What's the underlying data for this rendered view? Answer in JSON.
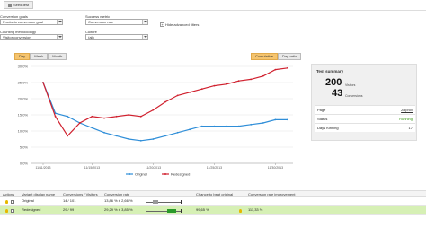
{
  "tab": {
    "label": "Seed-test"
  },
  "filters": {
    "conversion_goals": {
      "label": "Conversion goals",
      "value": "Products conversion goal"
    },
    "success_metric": {
      "label": "Success metric",
      "value": "Conversion rate"
    },
    "counting_methodology": {
      "label": "Counting methodology",
      "value": "Visitor conversion"
    },
    "culture": {
      "label": "Culture",
      "value": "(all)"
    },
    "hide_advanced": "Hide advanced filters"
  },
  "range_tabs": [
    "Day",
    "Week",
    "Month"
  ],
  "mode_tabs": [
    "Cumulative",
    "Day-ratio"
  ],
  "chart_data": {
    "type": "line",
    "x": [
      "11/11/2013",
      "11/12/2013",
      "11/13/2013",
      "11/14/2013",
      "11/15/2013",
      "11/16/2013",
      "11/17/2013",
      "11/18/2013",
      "11/19/2013",
      "11/20/2013",
      "11/21/2013",
      "11/22/2013",
      "11/23/2013",
      "11/24/2013",
      "11/25/2013",
      "11/26/2013",
      "11/27/2013",
      "11/28/2013",
      "11/29/2013",
      "11/30/2013",
      "12/1/2013"
    ],
    "x_tick_labels": [
      "11/11/2013",
      "11/15/2013",
      "11/20/2013",
      "11/25/2013",
      "11/30/2013"
    ],
    "x_tick_indices": [
      0,
      4,
      9,
      14,
      19
    ],
    "ylim": [
      0,
      30
    ],
    "y_ticks": [
      "0,0%",
      "5,0%",
      "10,0%",
      "15,0%",
      "20,0%",
      "25,0%",
      "30,0%"
    ],
    "series": [
      {
        "name": "Original",
        "color": "#2f8ed8",
        "values": [
          25.0,
          15.5,
          14.5,
          12.5,
          11.0,
          9.5,
          8.5,
          7.5,
          7.0,
          7.5,
          8.5,
          9.5,
          10.5,
          11.5,
          11.5,
          11.5,
          11.5,
          12.0,
          12.5,
          13.5,
          13.5
        ]
      },
      {
        "name": "Redesigned",
        "color": "#d0202e",
        "values": [
          25.0,
          14.5,
          8.5,
          12.5,
          14.5,
          14.0,
          14.5,
          15.0,
          14.5,
          16.5,
          19.0,
          21.0,
          22.0,
          23.0,
          24.0,
          24.5,
          25.5,
          26.0,
          27.0,
          29.0,
          29.5
        ]
      }
    ],
    "legend": "bottom"
  },
  "summary": {
    "title": "Test summary",
    "visitors_value": "200",
    "visitors_label": "Visitors",
    "conversions_value": "43",
    "conversions_label": "Conversions",
    "rows": [
      {
        "key": "Page",
        "value": "Zillprox"
      },
      {
        "key": "Status",
        "value": "Running"
      },
      {
        "key": "Days running",
        "value": "17"
      }
    ]
  },
  "table": {
    "headers": [
      "Actions",
      "Variant display name",
      "Conversions / Visitors",
      "Conversion rate",
      "Chance to beat original",
      "Conversion rate improvement"
    ],
    "rows": [
      {
        "name": "Original",
        "conv": "14 / 101",
        "rate": "13,86 % ± 2,66 %",
        "chance": "",
        "improvement": ""
      },
      {
        "name": "Redesigned",
        "conv": "29 / 99",
        "rate": "29,29 % ± 3,85 %",
        "chance": "99,65 %",
        "improvement": "111,33 %"
      }
    ]
  }
}
